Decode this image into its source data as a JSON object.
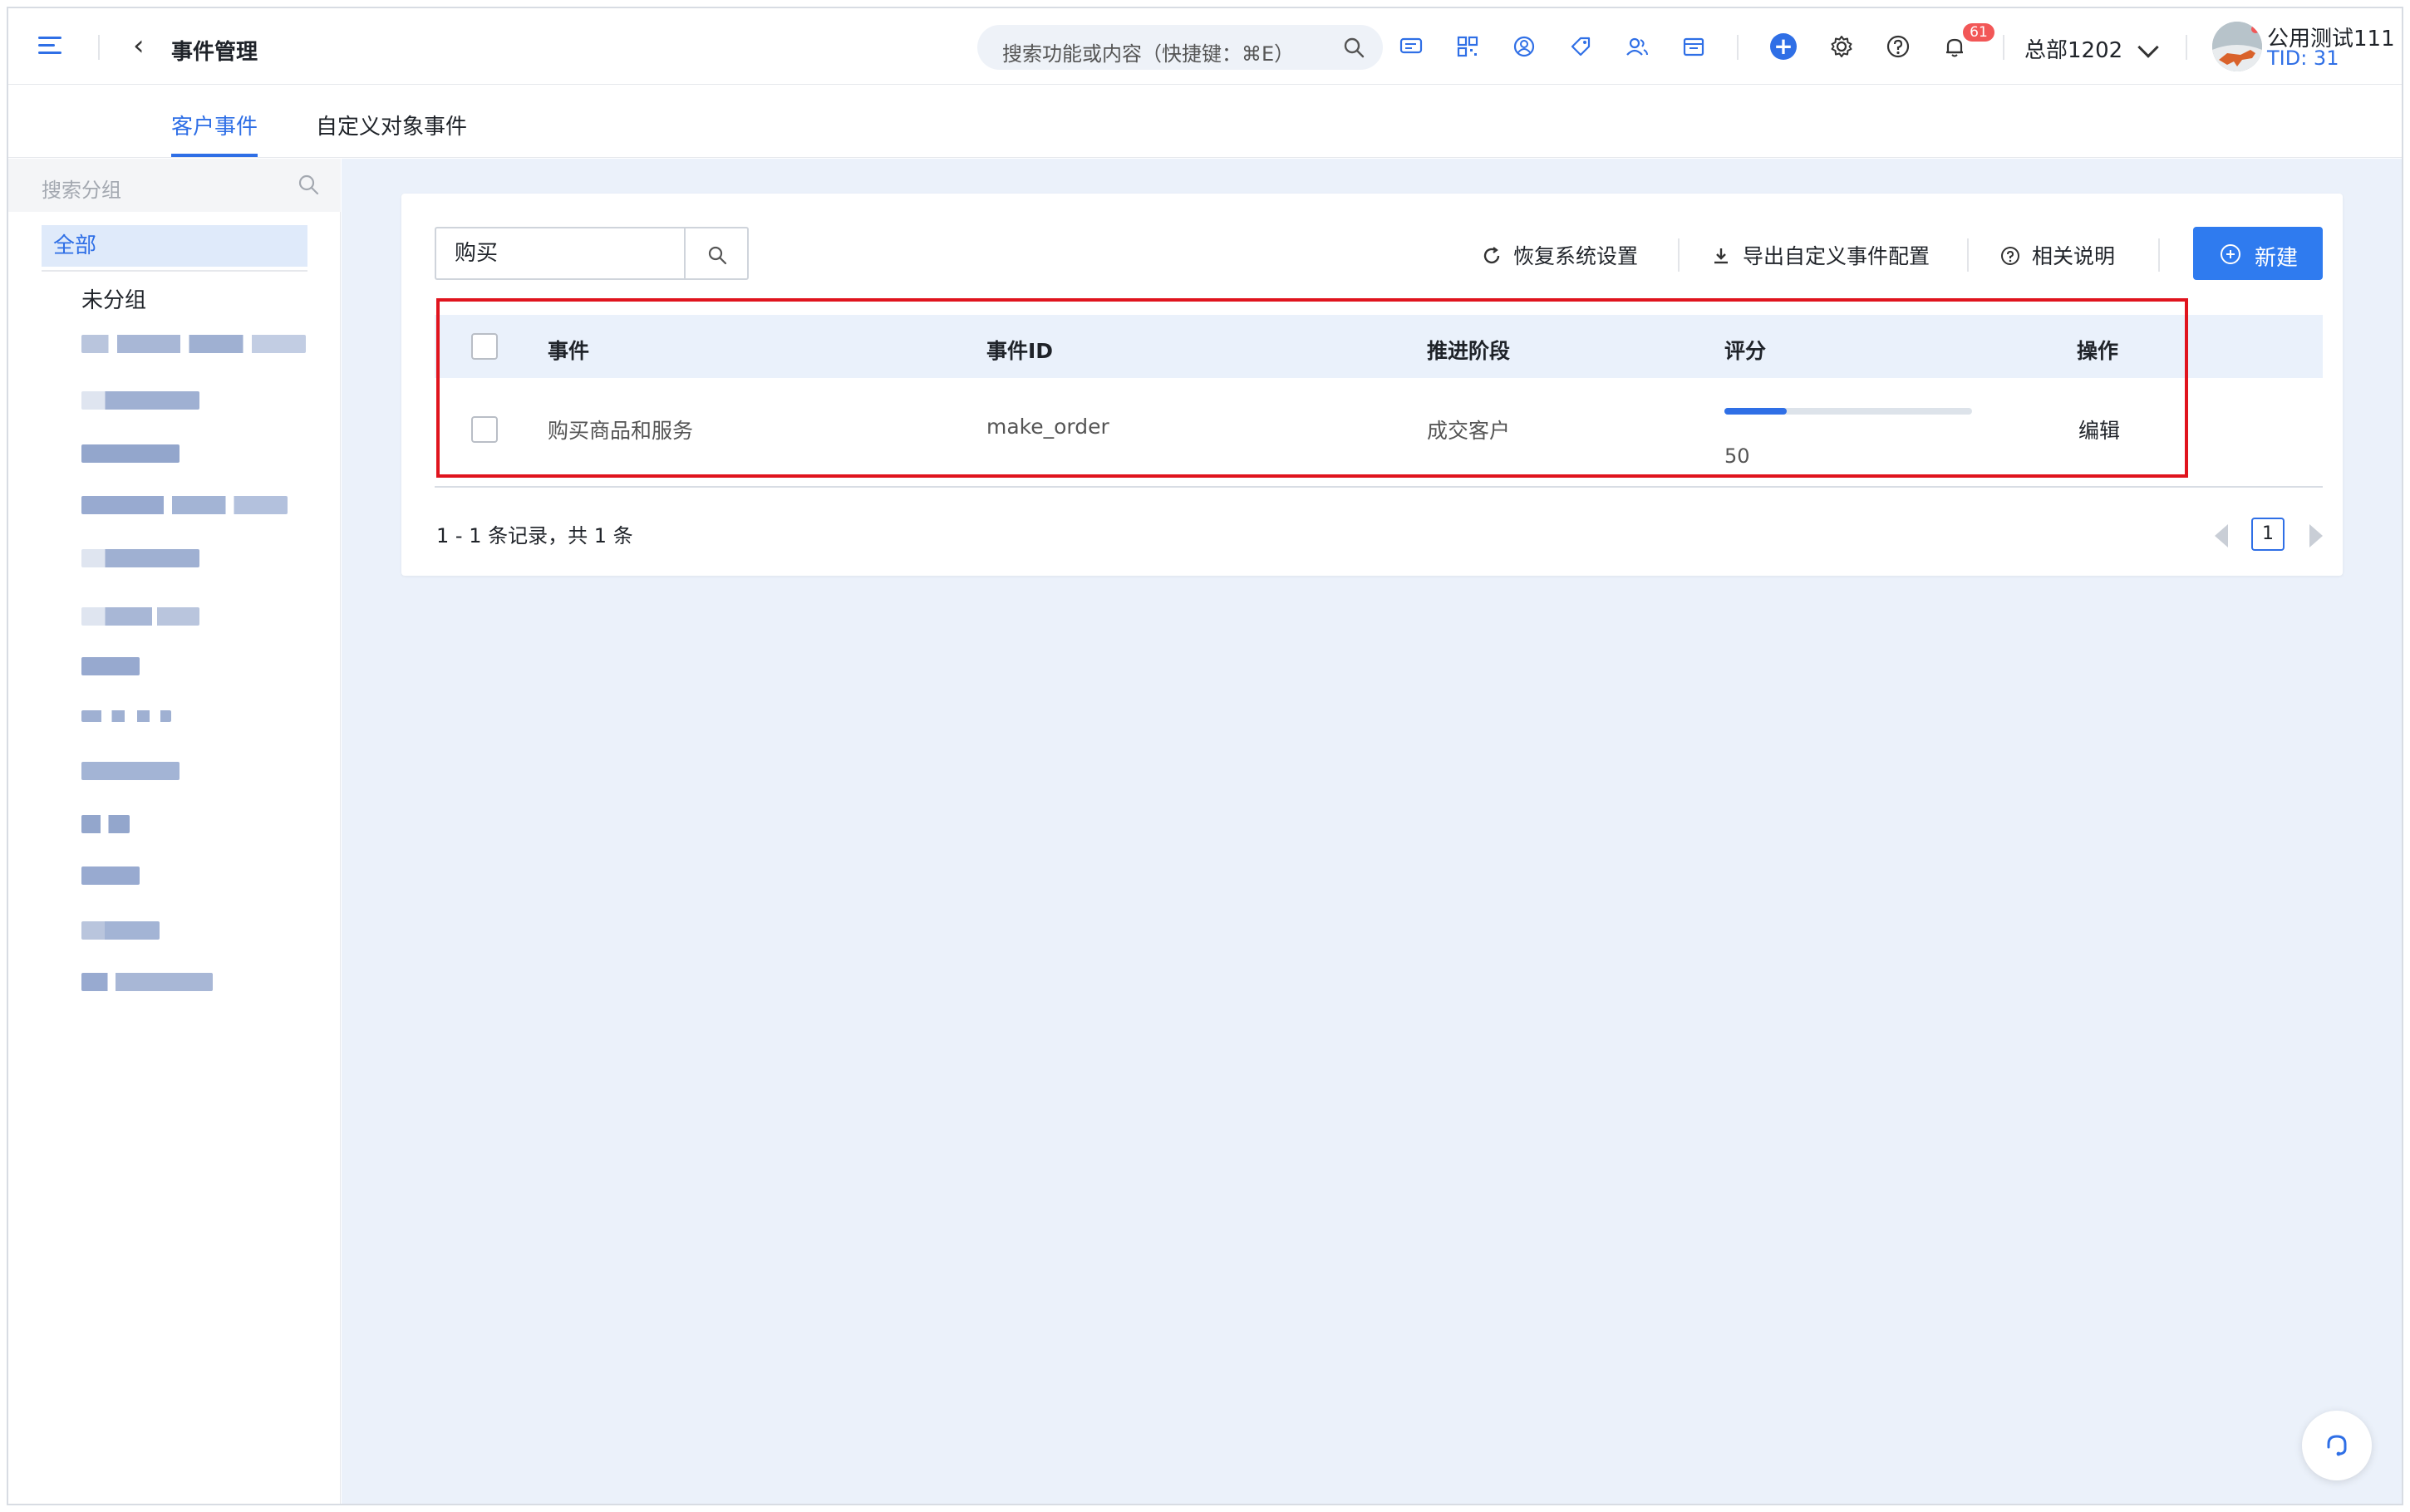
{
  "header": {
    "title": "事件管理",
    "global_search_placeholder": "搜索功能或内容（快捷键：⌘E）",
    "notification_count": "61",
    "org_name": "总部1202",
    "user_name": "公用测试111",
    "user_tid": "TID: 31",
    "accent_color": "#2f6fe6"
  },
  "tabs": [
    {
      "label": "客户事件",
      "active": true
    },
    {
      "label": "自定义对象事件",
      "active": false
    }
  ],
  "sidebar": {
    "search_placeholder": "搜索分组",
    "all_label": "全部",
    "ungrouped_label": "未分组"
  },
  "toolbar": {
    "search_value": "购买",
    "restore_label": "恢复系统设置",
    "export_label": "导出自定义事件配置",
    "help_label": "相关说明",
    "new_label": "新建"
  },
  "table": {
    "headers": {
      "event": "事件",
      "event_id": "事件ID",
      "stage": "推进阶段",
      "score": "评分",
      "action": "操作"
    },
    "rows": [
      {
        "event": "购买商品和服务",
        "event_id": "make_order",
        "stage": "成交客户",
        "score": "50",
        "score_fraction": 0.25,
        "action": "编辑"
      }
    ]
  },
  "pagination": {
    "summary": "1 - 1 条记录，共 1 条",
    "current_page": "1"
  },
  "collapse_handle": "II"
}
